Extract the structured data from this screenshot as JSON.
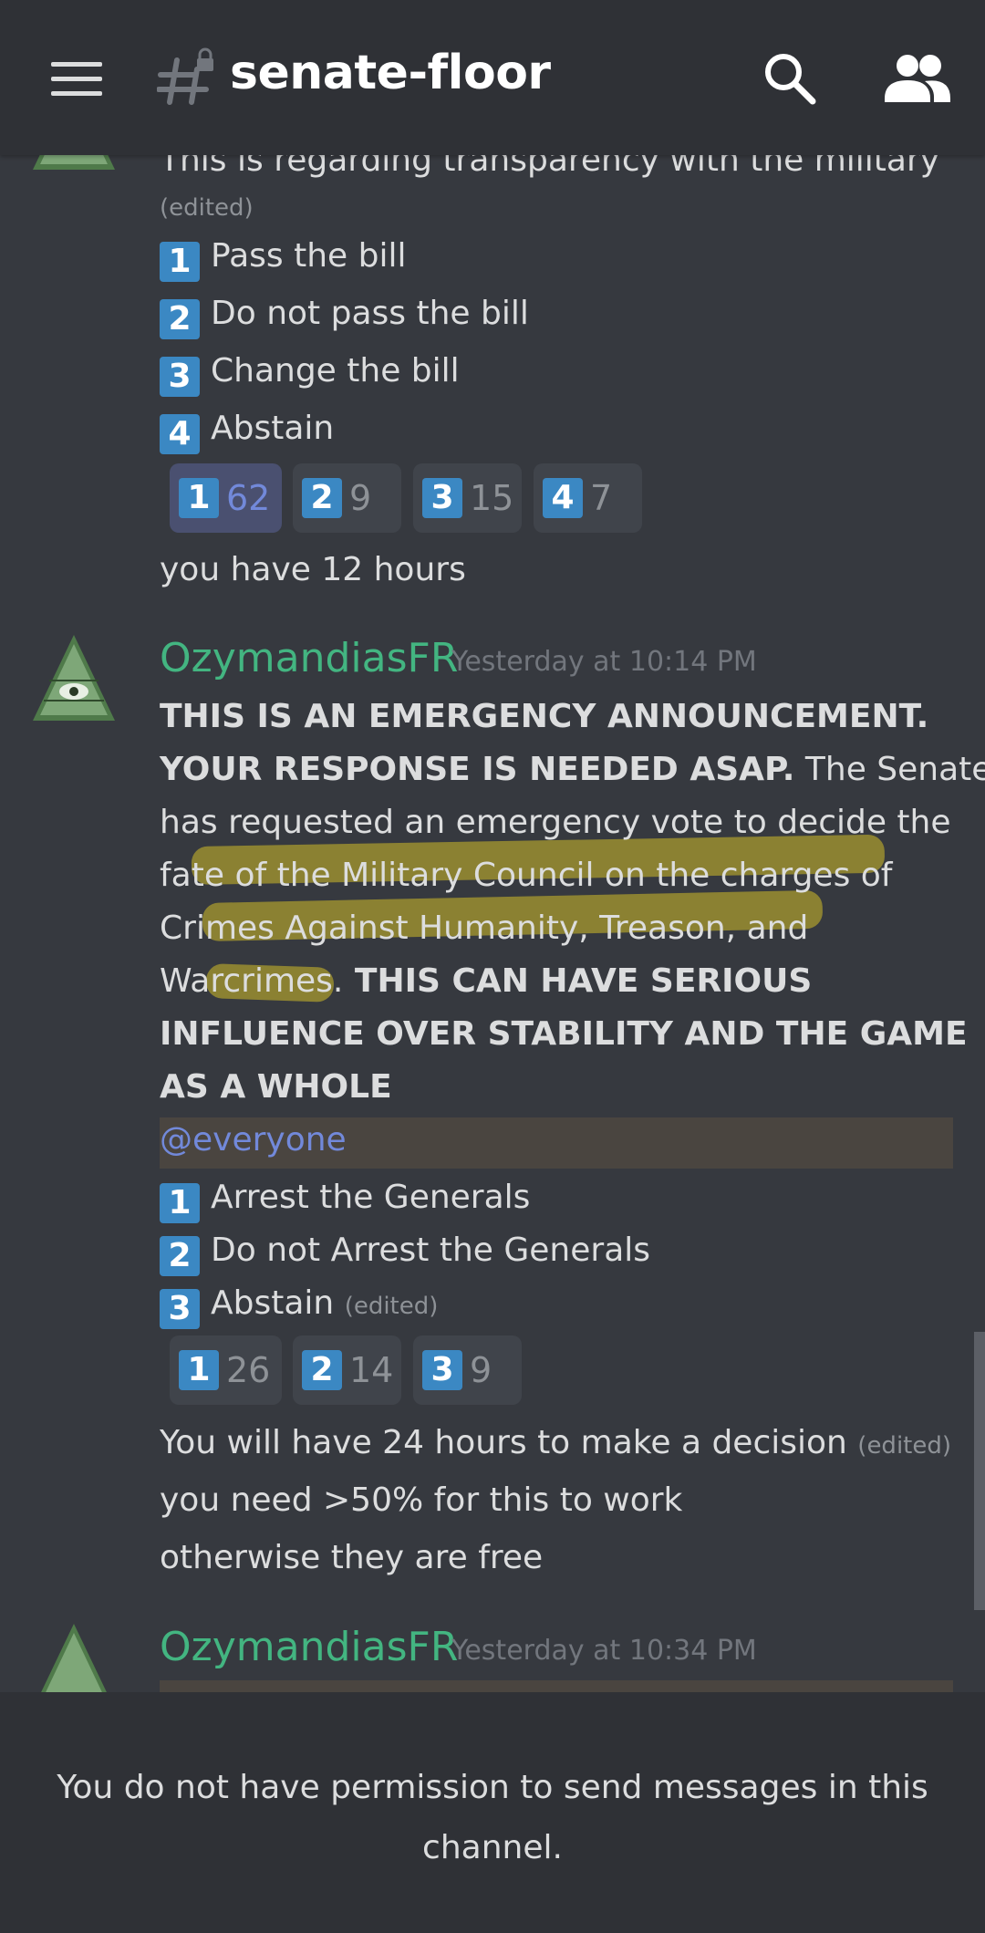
{
  "channel": {
    "name": "senate-floor"
  },
  "icons": {
    "menu": "hamburger-icon",
    "channel": "locked-channel-hash-icon",
    "search": "search-icon",
    "members": "members-icon"
  },
  "messages": {
    "prev": {
      "line1": "This is regarding transparency with the military",
      "edited": "(edited)",
      "options": [
        "Pass the bill",
        "Do not pass the bill",
        "Change the bill",
        "Abstain"
      ],
      "reactions": [
        {
          "emoji": "1",
          "count": "62",
          "own": true
        },
        {
          "emoji": "2",
          "count": "9",
          "own": false
        },
        {
          "emoji": "3",
          "count": "15",
          "own": false
        },
        {
          "emoji": "4",
          "count": "7",
          "own": false
        }
      ],
      "footer": "you have 12 hours"
    },
    "main": {
      "username": "OzymandiasFR",
      "timestamp": "Yesterday at 10:14 PM",
      "line1": "THIS IS AN EMERGENCY ANNOUNCEMENT.",
      "line2_bold": "YOUR RESPONSE IS NEEDED ASAP.",
      "line2_rest": " The Senate",
      "line3": "has requested an emergency vote to decide the",
      "line4": "fate of the Military Council on the charges of",
      "line5": "Crimes Against Humanity, Treason, and",
      "line6_rest": "Warcrimes.",
      "line6_bold": " THIS CAN HAVE SERIOUS",
      "line7": "INFLUENCE OVER STABILITY AND THE GAME",
      "line8": "AS A WHOLE",
      "mention": "@everyone",
      "options": [
        "Arrest the Generals",
        "Do not Arrest the Generals",
        "Abstain"
      ],
      "option_edited": "(edited)",
      "reactions": [
        {
          "emoji": "1",
          "count": "26"
        },
        {
          "emoji": "2",
          "count": "14"
        },
        {
          "emoji": "3",
          "count": "9"
        }
      ],
      "after1": "You will have 24 hours to make a decision",
      "after1_edited": "(edited)",
      "after2": "you need >50% for this to work",
      "after3": "otherwise they are free"
    },
    "next": {
      "username": "OzymandiasFR",
      "timestamp": "Yesterday at 10:34 PM"
    }
  },
  "colors": {
    "background": "#36393f",
    "header": "#2f3136",
    "username": "#43b581",
    "mention": "#7289da",
    "highlight": "#d2be28",
    "emoji_keycap": "#3b88c3"
  },
  "footer": {
    "notice": "You do not have permission to send messages in this channel."
  }
}
